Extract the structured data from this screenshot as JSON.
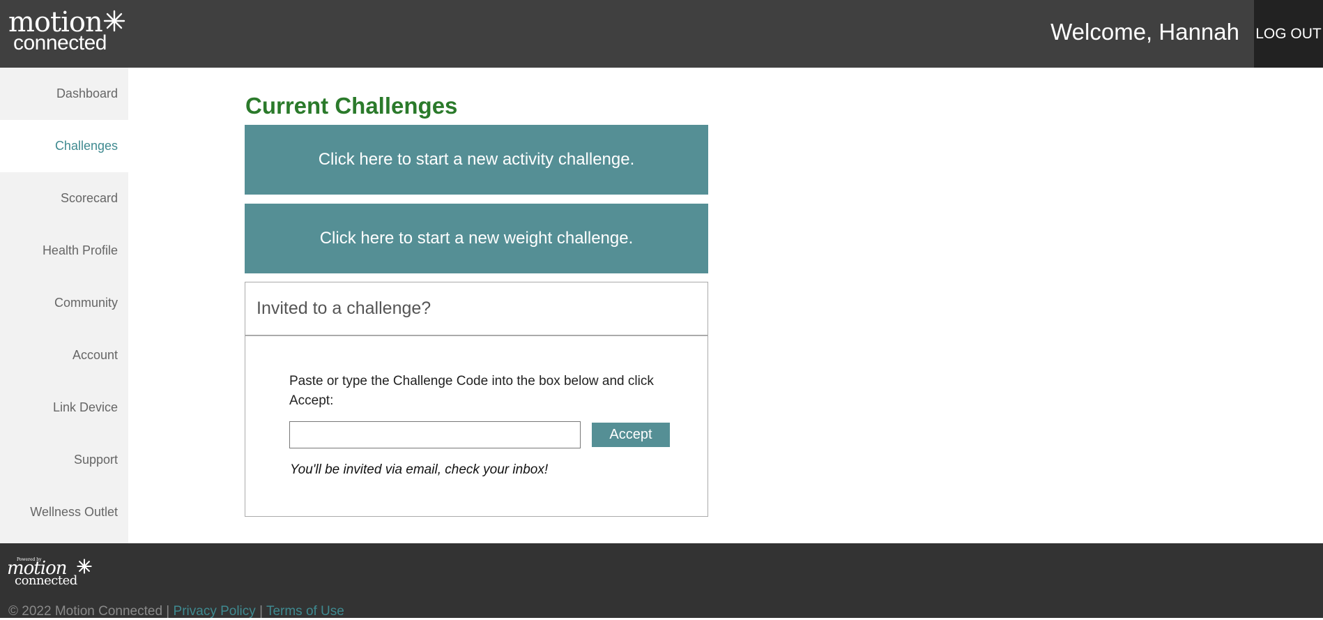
{
  "header": {
    "logo": {
      "line1": "motion",
      "line2": "connected"
    },
    "welcome": "Welcome, Hannah",
    "logout_label": "LOG OUT"
  },
  "sidebar": {
    "items": [
      {
        "label": "Dashboard"
      },
      {
        "label": "Challenges",
        "active": true
      },
      {
        "label": "Scorecard"
      },
      {
        "label": "Health Profile"
      },
      {
        "label": "Community"
      },
      {
        "label": "Account"
      },
      {
        "label": "Link Device"
      },
      {
        "label": "Support"
      },
      {
        "label": "Wellness Outlet"
      }
    ]
  },
  "main": {
    "title": "Current Challenges",
    "activity_cta": "Click here to start a new activity challenge.",
    "weight_cta": "Click here to start a new weight challenge.",
    "invite": {
      "heading": "Invited to a challenge?",
      "instructions": "Paste or type the Challenge Code into the box below and click Accept:",
      "code_value": "",
      "code_placeholder": "",
      "accept_label": "Accept",
      "note": "You'll be invited via email, check your inbox!"
    }
  },
  "footer": {
    "logo": {
      "powered": "Powered by",
      "line1": "motion",
      "line2": "connected"
    },
    "copyright": "© 2022 Motion Connected |",
    "privacy_label": "Privacy Policy",
    "separator": "|",
    "terms_label": "Terms of Use"
  },
  "colors": {
    "header_bg": "#404040",
    "accent_teal": "#558f95",
    "title_green": "#2b7a2b",
    "footer_bg": "#333333"
  }
}
